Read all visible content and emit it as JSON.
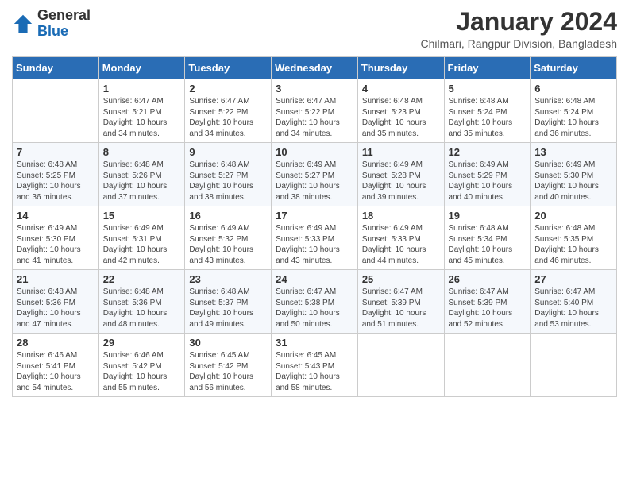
{
  "logo": {
    "general": "General",
    "blue": "Blue"
  },
  "title": "January 2024",
  "subtitle": "Chilmari, Rangpur Division, Bangladesh",
  "headers": [
    "Sunday",
    "Monday",
    "Tuesday",
    "Wednesday",
    "Thursday",
    "Friday",
    "Saturday"
  ],
  "weeks": [
    [
      {
        "day": "",
        "info": ""
      },
      {
        "day": "1",
        "info": "Sunrise: 6:47 AM\nSunset: 5:21 PM\nDaylight: 10 hours\nand 34 minutes."
      },
      {
        "day": "2",
        "info": "Sunrise: 6:47 AM\nSunset: 5:22 PM\nDaylight: 10 hours\nand 34 minutes."
      },
      {
        "day": "3",
        "info": "Sunrise: 6:47 AM\nSunset: 5:22 PM\nDaylight: 10 hours\nand 34 minutes."
      },
      {
        "day": "4",
        "info": "Sunrise: 6:48 AM\nSunset: 5:23 PM\nDaylight: 10 hours\nand 35 minutes."
      },
      {
        "day": "5",
        "info": "Sunrise: 6:48 AM\nSunset: 5:24 PM\nDaylight: 10 hours\nand 35 minutes."
      },
      {
        "day": "6",
        "info": "Sunrise: 6:48 AM\nSunset: 5:24 PM\nDaylight: 10 hours\nand 36 minutes."
      }
    ],
    [
      {
        "day": "7",
        "info": "Sunrise: 6:48 AM\nSunset: 5:25 PM\nDaylight: 10 hours\nand 36 minutes."
      },
      {
        "day": "8",
        "info": "Sunrise: 6:48 AM\nSunset: 5:26 PM\nDaylight: 10 hours\nand 37 minutes."
      },
      {
        "day": "9",
        "info": "Sunrise: 6:48 AM\nSunset: 5:27 PM\nDaylight: 10 hours\nand 38 minutes."
      },
      {
        "day": "10",
        "info": "Sunrise: 6:49 AM\nSunset: 5:27 PM\nDaylight: 10 hours\nand 38 minutes."
      },
      {
        "day": "11",
        "info": "Sunrise: 6:49 AM\nSunset: 5:28 PM\nDaylight: 10 hours\nand 39 minutes."
      },
      {
        "day": "12",
        "info": "Sunrise: 6:49 AM\nSunset: 5:29 PM\nDaylight: 10 hours\nand 40 minutes."
      },
      {
        "day": "13",
        "info": "Sunrise: 6:49 AM\nSunset: 5:30 PM\nDaylight: 10 hours\nand 40 minutes."
      }
    ],
    [
      {
        "day": "14",
        "info": "Sunrise: 6:49 AM\nSunset: 5:30 PM\nDaylight: 10 hours\nand 41 minutes."
      },
      {
        "day": "15",
        "info": "Sunrise: 6:49 AM\nSunset: 5:31 PM\nDaylight: 10 hours\nand 42 minutes."
      },
      {
        "day": "16",
        "info": "Sunrise: 6:49 AM\nSunset: 5:32 PM\nDaylight: 10 hours\nand 43 minutes."
      },
      {
        "day": "17",
        "info": "Sunrise: 6:49 AM\nSunset: 5:33 PM\nDaylight: 10 hours\nand 43 minutes."
      },
      {
        "day": "18",
        "info": "Sunrise: 6:49 AM\nSunset: 5:33 PM\nDaylight: 10 hours\nand 44 minutes."
      },
      {
        "day": "19",
        "info": "Sunrise: 6:48 AM\nSunset: 5:34 PM\nDaylight: 10 hours\nand 45 minutes."
      },
      {
        "day": "20",
        "info": "Sunrise: 6:48 AM\nSunset: 5:35 PM\nDaylight: 10 hours\nand 46 minutes."
      }
    ],
    [
      {
        "day": "21",
        "info": "Sunrise: 6:48 AM\nSunset: 5:36 PM\nDaylight: 10 hours\nand 47 minutes."
      },
      {
        "day": "22",
        "info": "Sunrise: 6:48 AM\nSunset: 5:36 PM\nDaylight: 10 hours\nand 48 minutes."
      },
      {
        "day": "23",
        "info": "Sunrise: 6:48 AM\nSunset: 5:37 PM\nDaylight: 10 hours\nand 49 minutes."
      },
      {
        "day": "24",
        "info": "Sunrise: 6:47 AM\nSunset: 5:38 PM\nDaylight: 10 hours\nand 50 minutes."
      },
      {
        "day": "25",
        "info": "Sunrise: 6:47 AM\nSunset: 5:39 PM\nDaylight: 10 hours\nand 51 minutes."
      },
      {
        "day": "26",
        "info": "Sunrise: 6:47 AM\nSunset: 5:39 PM\nDaylight: 10 hours\nand 52 minutes."
      },
      {
        "day": "27",
        "info": "Sunrise: 6:47 AM\nSunset: 5:40 PM\nDaylight: 10 hours\nand 53 minutes."
      }
    ],
    [
      {
        "day": "28",
        "info": "Sunrise: 6:46 AM\nSunset: 5:41 PM\nDaylight: 10 hours\nand 54 minutes."
      },
      {
        "day": "29",
        "info": "Sunrise: 6:46 AM\nSunset: 5:42 PM\nDaylight: 10 hours\nand 55 minutes."
      },
      {
        "day": "30",
        "info": "Sunrise: 6:45 AM\nSunset: 5:42 PM\nDaylight: 10 hours\nand 56 minutes."
      },
      {
        "day": "31",
        "info": "Sunrise: 6:45 AM\nSunset: 5:43 PM\nDaylight: 10 hours\nand 58 minutes."
      },
      {
        "day": "",
        "info": ""
      },
      {
        "day": "",
        "info": ""
      },
      {
        "day": "",
        "info": ""
      }
    ]
  ]
}
